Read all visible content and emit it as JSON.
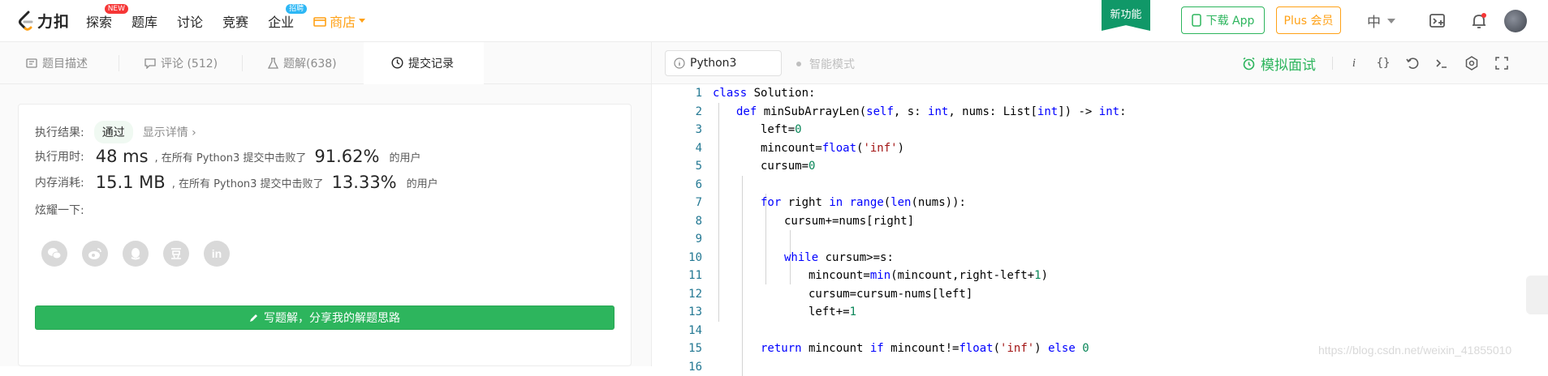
{
  "header": {
    "logo_text": "力扣",
    "nav": [
      {
        "label": "探索",
        "badge": "NEW"
      },
      {
        "label": "题库",
        "badge": ""
      },
      {
        "label": "讨论",
        "badge": ""
      },
      {
        "label": "竞赛",
        "badge": ""
      },
      {
        "label": "企业",
        "badge": "招聘"
      }
    ],
    "store_label": "商店",
    "new_feature": "新功能",
    "download_app": "下载 App",
    "plus_member": "Plus 会员",
    "language": "中",
    "colors": {
      "brand_green": "#2db55d",
      "brand_orange": "#ffa116",
      "new_badge": "#f63636"
    }
  },
  "left_tabs": [
    {
      "label": "题目描述",
      "icon": "description-icon"
    },
    {
      "label": "评论 (512)",
      "icon": "comment-icon"
    },
    {
      "label": "题解(638)",
      "icon": "flask-icon"
    },
    {
      "label": "提交记录",
      "icon": "clock-icon"
    }
  ],
  "result": {
    "status_label": "执行结果:",
    "status_value": "通过",
    "detail_link": "显示详情 ›",
    "time_label": "执行用时:",
    "time_value": "48 ms",
    "time_text": ", 在所有 Python3 提交中击败了",
    "time_percent": "91.62%",
    "users_text": "的用户",
    "memory_label": "内存消耗:",
    "memory_value": "15.1 MB",
    "memory_text": ", 在所有 Python3 提交中击败了",
    "memory_percent": "13.33%",
    "share_label": "炫耀一下:",
    "share_icons": [
      "wechat-icon",
      "weibo-icon",
      "qq-icon",
      "douban-icon",
      "linkedin-icon"
    ],
    "write_button": "写题解，分享我的解题思路"
  },
  "editor": {
    "language": "Python3",
    "smart_mode": "智能模式",
    "mock_interview": "模拟面试",
    "lines": [
      {
        "n": "1"
      },
      {
        "n": "2"
      },
      {
        "n": "3"
      },
      {
        "n": "4"
      },
      {
        "n": "5"
      },
      {
        "n": "6"
      },
      {
        "n": "7"
      },
      {
        "n": "8"
      },
      {
        "n": "9"
      },
      {
        "n": "10"
      },
      {
        "n": "11"
      },
      {
        "n": "12"
      },
      {
        "n": "13"
      },
      {
        "n": "14"
      },
      {
        "n": "15"
      },
      {
        "n": "16"
      }
    ],
    "code": {
      "l1_kw": "class",
      "l1_rest": " Solution:",
      "l2_kw": "def",
      "l2_a": " minSubArrayLen(",
      "l2_self": "self",
      "l2_b": ", s: ",
      "l2_int1": "int",
      "l2_c": ", nums: List[",
      "l2_int2": "int",
      "l2_d": "]) -> ",
      "l2_int3": "int",
      "l2_e": ":",
      "l3_a": "left=",
      "l3_num": "0",
      "l4_a": "mincount=",
      "l4_fn": "float",
      "l4_b": "(",
      "l4_str": "'inf'",
      "l4_c": ")",
      "l5_a": "cursum=",
      "l5_num": "0",
      "l7_kw1": "for",
      "l7_a": " right ",
      "l7_kw2": "in",
      "l7_b": " ",
      "l7_fn1": "range",
      "l7_c": "(",
      "l7_fn2": "len",
      "l7_d": "(nums)):",
      "l8": "cursum+=nums[right]",
      "l10_kw": "while",
      "l10_rest": " cursum>=s:",
      "l11_a": "mincount=",
      "l11_fn": "min",
      "l11_b": "(mincount,right-left+",
      "l11_num": "1",
      "l11_c": ")",
      "l12": "cursum=cursum-nums[left]",
      "l13_a": "left+=",
      "l13_num": "1",
      "l15_kw1": "return",
      "l15_a": " mincount ",
      "l15_kw2": "if",
      "l15_b": " mincount!=",
      "l15_fn": "float",
      "l15_c": "(",
      "l15_str": "'inf'",
      "l15_d": ") ",
      "l15_kw3": "else",
      "l15_e": " ",
      "l15_num": "0"
    }
  },
  "watermark": "https://blog.csdn.net/weixin_41855010"
}
